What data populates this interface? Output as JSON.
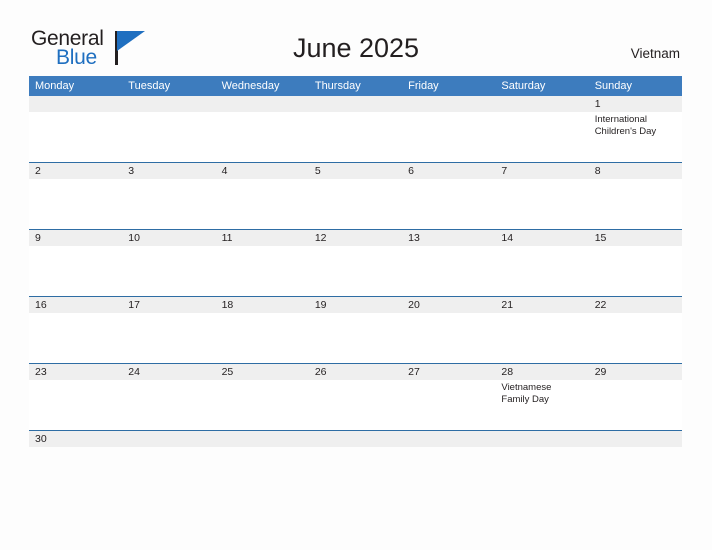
{
  "brand": {
    "name_part1": "General",
    "name_part2": "Blue",
    "accent_color": "#1f6fc0",
    "triangle_icon": "blue-triangle-icon"
  },
  "header": {
    "title": "June 2025",
    "country": "Vietnam"
  },
  "theme": {
    "header_bar_color": "#3d7cbe",
    "row_divider_color": "#2e6da4",
    "day_number_band_color": "#efefef",
    "text_color": "#231f20",
    "page_background": "#fdfdfd"
  },
  "calendar": {
    "weekdays": [
      "Monday",
      "Tuesday",
      "Wednesday",
      "Thursday",
      "Friday",
      "Saturday",
      "Sunday"
    ],
    "weeks": [
      {
        "short": false,
        "days": [
          {
            "num": "",
            "empty": true,
            "events": []
          },
          {
            "num": "",
            "empty": true,
            "events": []
          },
          {
            "num": "",
            "empty": true,
            "events": []
          },
          {
            "num": "",
            "empty": true,
            "events": []
          },
          {
            "num": "",
            "empty": true,
            "events": []
          },
          {
            "num": "",
            "empty": true,
            "events": []
          },
          {
            "num": "1",
            "empty": false,
            "events": [
              "International Children's Day"
            ]
          }
        ]
      },
      {
        "short": false,
        "days": [
          {
            "num": "2",
            "empty": false,
            "events": []
          },
          {
            "num": "3",
            "empty": false,
            "events": []
          },
          {
            "num": "4",
            "empty": false,
            "events": []
          },
          {
            "num": "5",
            "empty": false,
            "events": []
          },
          {
            "num": "6",
            "empty": false,
            "events": []
          },
          {
            "num": "7",
            "empty": false,
            "events": []
          },
          {
            "num": "8",
            "empty": false,
            "events": []
          }
        ]
      },
      {
        "short": false,
        "days": [
          {
            "num": "9",
            "empty": false,
            "events": []
          },
          {
            "num": "10",
            "empty": false,
            "events": []
          },
          {
            "num": "11",
            "empty": false,
            "events": []
          },
          {
            "num": "12",
            "empty": false,
            "events": []
          },
          {
            "num": "13",
            "empty": false,
            "events": []
          },
          {
            "num": "14",
            "empty": false,
            "events": []
          },
          {
            "num": "15",
            "empty": false,
            "events": []
          }
        ]
      },
      {
        "short": false,
        "days": [
          {
            "num": "16",
            "empty": false,
            "events": []
          },
          {
            "num": "17",
            "empty": false,
            "events": []
          },
          {
            "num": "18",
            "empty": false,
            "events": []
          },
          {
            "num": "19",
            "empty": false,
            "events": []
          },
          {
            "num": "20",
            "empty": false,
            "events": []
          },
          {
            "num": "21",
            "empty": false,
            "events": []
          },
          {
            "num": "22",
            "empty": false,
            "events": []
          }
        ]
      },
      {
        "short": false,
        "days": [
          {
            "num": "23",
            "empty": false,
            "events": []
          },
          {
            "num": "24",
            "empty": false,
            "events": []
          },
          {
            "num": "25",
            "empty": false,
            "events": []
          },
          {
            "num": "26",
            "empty": false,
            "events": []
          },
          {
            "num": "27",
            "empty": false,
            "events": []
          },
          {
            "num": "28",
            "empty": false,
            "events": [
              "Vietnamese Family Day"
            ]
          },
          {
            "num": "29",
            "empty": false,
            "events": []
          }
        ]
      },
      {
        "short": true,
        "days": [
          {
            "num": "30",
            "empty": false,
            "events": []
          },
          {
            "num": "",
            "empty": true,
            "events": []
          },
          {
            "num": "",
            "empty": true,
            "events": []
          },
          {
            "num": "",
            "empty": true,
            "events": []
          },
          {
            "num": "",
            "empty": true,
            "events": []
          },
          {
            "num": "",
            "empty": true,
            "events": []
          },
          {
            "num": "",
            "empty": true,
            "events": []
          }
        ]
      }
    ]
  }
}
